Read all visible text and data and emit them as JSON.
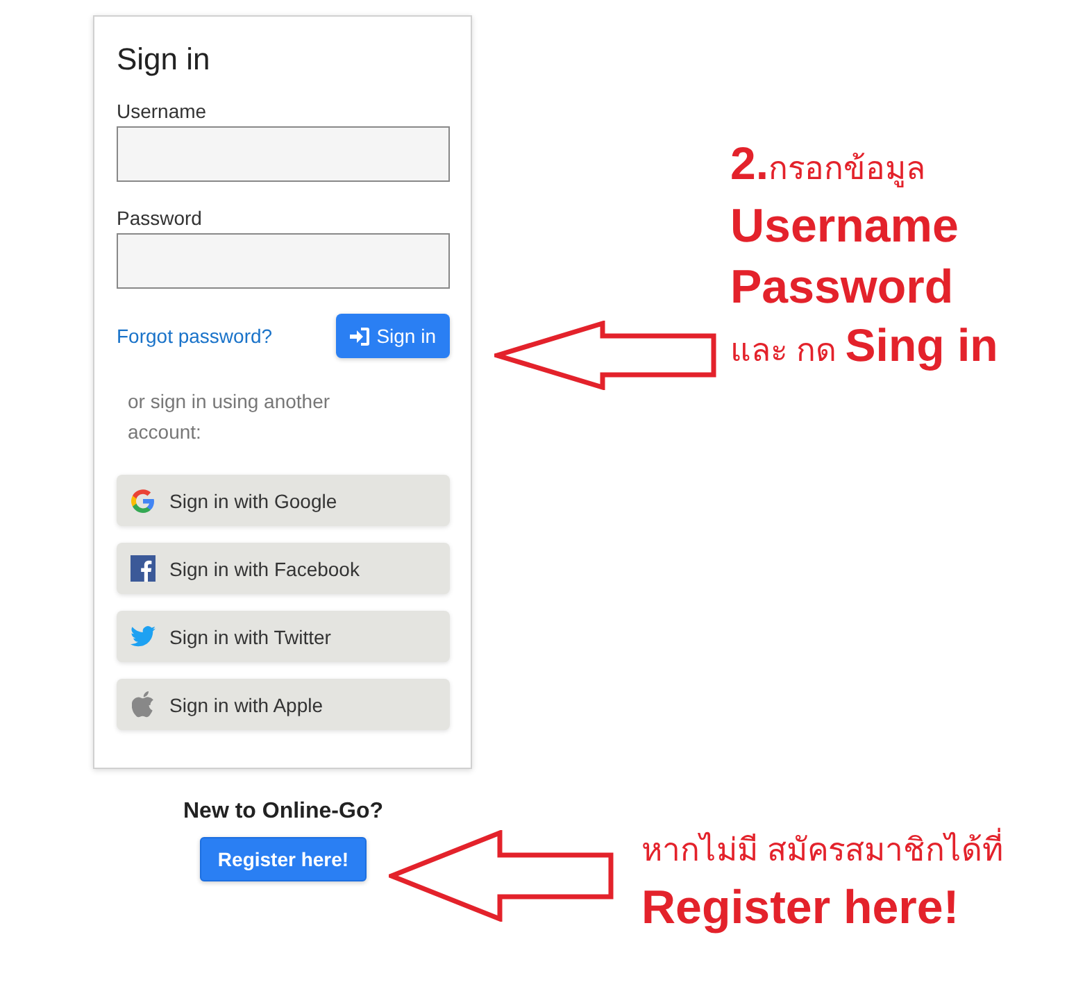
{
  "card": {
    "title": "Sign in",
    "fields": [
      {
        "label": "Username"
      },
      {
        "label": "Password"
      }
    ],
    "forgot_link": "Forgot password?",
    "sign_in_button": "Sign in",
    "alt_text": "or sign in using another account:",
    "providers": [
      {
        "kind": "google",
        "label": "Sign in with Google"
      },
      {
        "kind": "facebook",
        "label": "Sign in with Facebook"
      },
      {
        "kind": "twitter",
        "label": "Sign in with Twitter"
      },
      {
        "kind": "apple",
        "label": "Sign in with Apple"
      }
    ]
  },
  "register": {
    "prompt": "New to Online-Go?",
    "button": "Register here!"
  },
  "annotations": [
    {
      "lines": [
        {
          "kind": "note",
          "text": "**2.**กรอกข้อมูล"
        },
        {
          "kind": "big",
          "text": "Username"
        },
        {
          "kind": "big",
          "text": "Password"
        },
        {
          "kind": "note",
          "text": "และ กด **Sing in**"
        }
      ]
    },
    {
      "lines": [
        {
          "kind": "note",
          "text": "หากไม่มี สมัครสมาชิกได้ที่"
        },
        {
          "kind": "big",
          "text": "Register here!"
        }
      ]
    }
  ]
}
